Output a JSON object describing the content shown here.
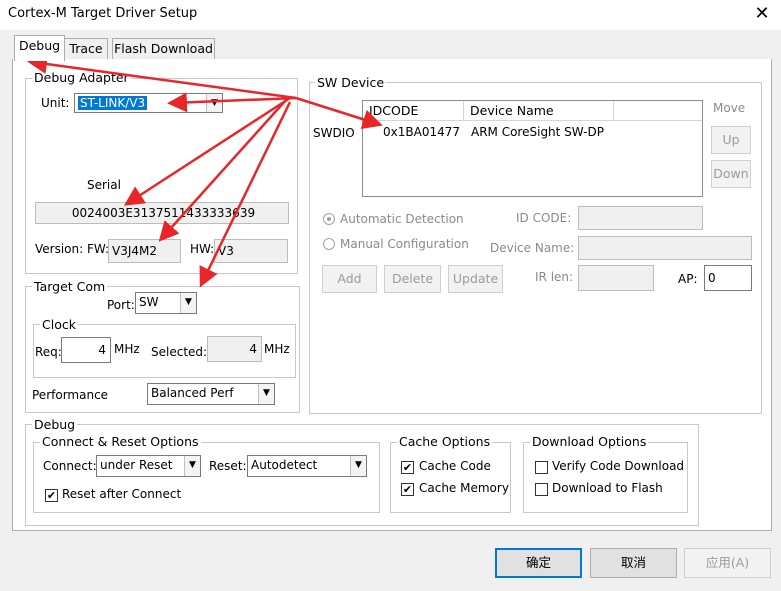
{
  "window": {
    "title": "Cortex-M Target Driver Setup",
    "close_glyph": "✕"
  },
  "tabs": [
    {
      "label": "Debug",
      "active": true
    },
    {
      "label": "Trace",
      "active": false
    },
    {
      "label": "Flash Download",
      "active": false
    }
  ],
  "debug_adapter": {
    "group_label": "Debug Adapter",
    "unit_label": "Unit:",
    "unit_value": "ST-LINK/V3",
    "serial_label": "Serial",
    "serial_value": "0024003E3137511433333639",
    "version_label": "Version: FW:",
    "fw_value": "V3J4M2",
    "hw_label": "HW:",
    "hw_value": "V3"
  },
  "target_com": {
    "group_label": "Target Com",
    "port_label": "Port:",
    "port_value": "SW",
    "clock": {
      "group_label": "Clock",
      "req_label": "Req:",
      "req_value": "4",
      "req_unit": "MHz",
      "selected_label": "Selected:",
      "selected_value": "4",
      "selected_unit": "MHz"
    },
    "performance_label": "Performance",
    "performance_value": "Balanced Perf"
  },
  "sw_device": {
    "group_label": "SW Device",
    "columns": [
      "IDCODE",
      "Device Name"
    ],
    "row_label": "SWDIO",
    "rows": [
      {
        "idcode": "0x1BA01477",
        "device_name": "ARM CoreSight SW-DP"
      }
    ],
    "move_label": "Move",
    "up_label": "Up",
    "down_label": "Down",
    "auto_detection_label": "Automatic Detection",
    "auto_detection_selected": true,
    "manual_config_label": "Manual Configuration",
    "id_code_label": "ID CODE:",
    "device_name_label": "Device Name:",
    "add_label": "Add",
    "delete_label": "Delete",
    "update_label": "Update",
    "ir_len_label": "IR len:",
    "ap_label": "AP:",
    "ap_value": "0"
  },
  "debug_section": {
    "group_label": "Debug",
    "connect_reset": {
      "group_label": "Connect & Reset Options",
      "connect_label": "Connect:",
      "connect_value": "under Reset",
      "reset_label": "Reset:",
      "reset_value": "Autodetect",
      "reset_after_connect_label": "Reset after Connect",
      "reset_after_connect_checked": true
    },
    "cache": {
      "group_label": "Cache Options",
      "cache_code_label": "Cache Code",
      "cache_code_checked": true,
      "cache_memory_label": "Cache Memory",
      "cache_memory_checked": true
    },
    "download": {
      "group_label": "Download Options",
      "verify_label": "Verify Code Download",
      "verify_checked": false,
      "download_flash_label": "Download to Flash",
      "download_flash_checked": false
    }
  },
  "footer": {
    "ok_label": "确定",
    "cancel_label": "取消",
    "apply_label": "应用(A)"
  },
  "colors": {
    "selection": "#0078d7",
    "annotation_arrow": "#e8262a",
    "disabled_text": "#8a8a8a"
  },
  "check_glyph": "✔",
  "dropdown_glyph": "▼"
}
